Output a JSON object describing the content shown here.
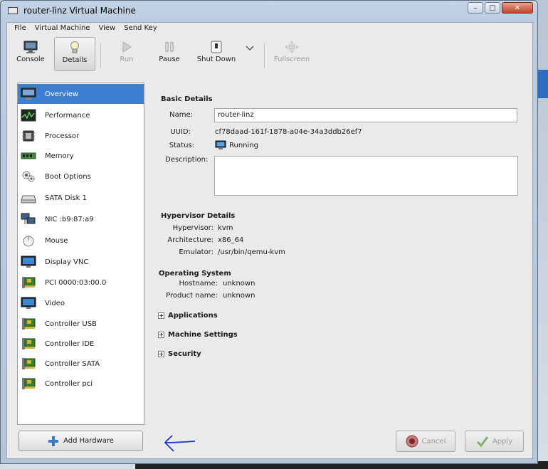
{
  "window": {
    "title": "router-linz Virtual Machine"
  },
  "menubar": [
    "File",
    "Virtual Machine",
    "View",
    "Send Key"
  ],
  "toolbar": {
    "console": "Console",
    "details": "Details",
    "run": "Run",
    "pause": "Pause",
    "shutdown": "Shut Down",
    "fullscreen": "Fullscreen"
  },
  "sidebar": {
    "items": [
      {
        "label": "Overview",
        "icon": "monitor-icon"
      },
      {
        "label": "Performance",
        "icon": "performance-graph-icon"
      },
      {
        "label": "Processor",
        "icon": "cpu-chip-icon"
      },
      {
        "label": "Memory",
        "icon": "memory-module-icon"
      },
      {
        "label": "Boot Options",
        "icon": "gears-icon"
      },
      {
        "label": "SATA Disk 1",
        "icon": "hard-disk-icon"
      },
      {
        "label": "NIC :b9:87:a9",
        "icon": "network-icon"
      },
      {
        "label": "Mouse",
        "icon": "mouse-icon"
      },
      {
        "label": "Display VNC",
        "icon": "display-icon"
      },
      {
        "label": "PCI 0000:03:00.0",
        "icon": "pci-card-icon"
      },
      {
        "label": "Video",
        "icon": "video-icon"
      },
      {
        "label": "Controller USB",
        "icon": "controller-card-icon"
      },
      {
        "label": "Controller IDE",
        "icon": "controller-card-icon"
      },
      {
        "label": "Controller SATA",
        "icon": "controller-card-icon"
      },
      {
        "label": "Controller pci",
        "icon": "controller-card-icon"
      }
    ],
    "add_hardware": "Add Hardware"
  },
  "basic": {
    "title": "Basic Details",
    "name_label": "Name:",
    "name_value": "router-linz",
    "uuid_label": "UUID:",
    "uuid_value": "cf78daad-161f-1878-a04e-34a3ddb26ef7",
    "status_label": "Status:",
    "status_value": "Running",
    "desc_label": "Description:"
  },
  "hypervisor": {
    "title": "Hypervisor Details",
    "hv_label": "Hypervisor:",
    "hv_value": "kvm",
    "arch_label": "Architecture:",
    "arch_value": "x86_64",
    "emu_label": "Emulator:",
    "emu_value": "/usr/bin/qemu-kvm"
  },
  "os": {
    "title": "Operating System",
    "host_label": "Hostname:",
    "host_value": "unknown",
    "prod_label": "Product name:",
    "prod_value": "unknown"
  },
  "expanders": {
    "applications": "Applications",
    "machine_settings": "Machine Settings",
    "security": "Security"
  },
  "buttons": {
    "cancel": "Cancel",
    "apply": "Apply"
  },
  "colors": {
    "selection": "#3d7fd1"
  }
}
